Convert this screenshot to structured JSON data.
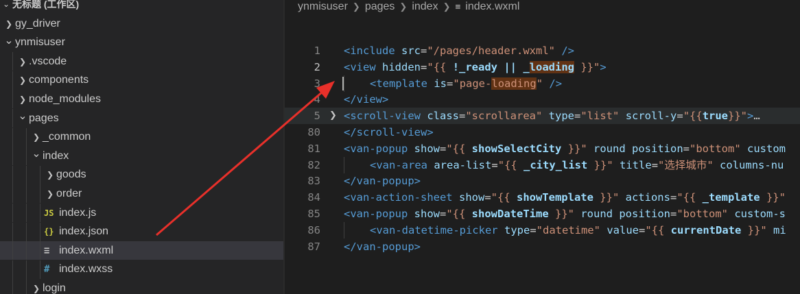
{
  "explorer": {
    "workspace_title": "无标题 (工作区)",
    "items": [
      {
        "label": "gy_driver",
        "chevron": "right",
        "icon": ""
      },
      {
        "label": "ynmisuser",
        "chevron": "down",
        "icon": ""
      },
      {
        "label": ".vscode",
        "chevron": "right",
        "icon": ""
      },
      {
        "label": "components",
        "chevron": "right",
        "icon": ""
      },
      {
        "label": "node_modules",
        "chevron": "right",
        "icon": ""
      },
      {
        "label": "pages",
        "chevron": "down",
        "icon": ""
      },
      {
        "label": "_common",
        "chevron": "right",
        "icon": ""
      },
      {
        "label": "index",
        "chevron": "down",
        "icon": ""
      },
      {
        "label": "goods",
        "chevron": "right",
        "icon": ""
      },
      {
        "label": "order",
        "chevron": "right",
        "icon": ""
      },
      {
        "label": "index.js",
        "chevron": "",
        "icon": "JS"
      },
      {
        "label": "index.json",
        "chevron": "",
        "icon": "{}"
      },
      {
        "label": "index.wxml",
        "chevron": "",
        "icon": "≡"
      },
      {
        "label": "index.wxss",
        "chevron": "",
        "icon": "#"
      },
      {
        "label": "login",
        "chevron": "right",
        "icon": ""
      }
    ],
    "selected_label": "index.wxml",
    "colors": {
      "js_icon": "#cbcb41",
      "json_icon": "#cbcb41",
      "wxml_icon": "#c5c5c5",
      "wxss_icon": "#519aba"
    }
  },
  "breadcrumb": {
    "segments": [
      "ynmisuser",
      "pages",
      "index",
      "index.wxml"
    ],
    "file_icon": "≡"
  },
  "editor": {
    "lines": [
      {
        "num": "1",
        "tokens": [
          [
            "t-tag",
            "<include"
          ],
          [
            "t-txt",
            " "
          ],
          [
            "t-attr",
            "src"
          ],
          [
            "t-txt",
            "="
          ],
          [
            "t-str",
            "\"/pages/header.wxml\""
          ],
          [
            "t-txt",
            " "
          ],
          [
            "t-tag",
            "/>"
          ]
        ]
      },
      {
        "num": "2",
        "active": true,
        "tokens": [
          [
            "t-tag",
            "<view"
          ],
          [
            "t-txt",
            " "
          ],
          [
            "t-attr",
            "hidden"
          ],
          [
            "t-txt",
            "="
          ],
          [
            "t-str",
            "\"{{ "
          ],
          [
            "t-mus",
            "!_ready || _"
          ],
          [
            "t-mus t-hi",
            "loading"
          ],
          [
            "t-str",
            " }}\""
          ],
          [
            "t-tag",
            ">"
          ]
        ]
      },
      {
        "num": "3",
        "indent": 1,
        "cursor": true,
        "tokens": [
          [
            "t-tag",
            "<template"
          ],
          [
            "t-txt",
            " "
          ],
          [
            "t-attr",
            "is"
          ],
          [
            "t-txt",
            "="
          ],
          [
            "t-str",
            "\"page-"
          ],
          [
            "t-str t-hi",
            "loading"
          ],
          [
            "t-str",
            "\""
          ],
          [
            "t-txt",
            " "
          ],
          [
            "t-tag",
            "/>"
          ]
        ]
      },
      {
        "num": "4",
        "tokens": [
          [
            "t-tag",
            "</view>"
          ]
        ]
      },
      {
        "num": "5",
        "folded": true,
        "highlight": true,
        "tokens": [
          [
            "t-tag",
            "<scroll-view"
          ],
          [
            "t-txt",
            " "
          ],
          [
            "t-attr",
            "class"
          ],
          [
            "t-txt",
            "="
          ],
          [
            "t-str",
            "\"scrollarea\""
          ],
          [
            "t-txt",
            " "
          ],
          [
            "t-attr",
            "type"
          ],
          [
            "t-txt",
            "="
          ],
          [
            "t-str",
            "\"list\""
          ],
          [
            "t-txt",
            " "
          ],
          [
            "t-attr",
            "scroll-y"
          ],
          [
            "t-txt",
            "="
          ],
          [
            "t-str",
            "\"{{"
          ],
          [
            "t-mus",
            "true"
          ],
          [
            "t-str",
            "}}\""
          ],
          [
            "t-tag",
            ">"
          ],
          [
            "ellipsis",
            "…"
          ]
        ]
      },
      {
        "num": "80",
        "tokens": [
          [
            "t-tag",
            "</scroll-view>"
          ]
        ]
      },
      {
        "num": "81",
        "tokens": [
          [
            "t-tag",
            "<van-popup"
          ],
          [
            "t-txt",
            " "
          ],
          [
            "t-attr",
            "show"
          ],
          [
            "t-txt",
            "="
          ],
          [
            "t-str",
            "\"{{ "
          ],
          [
            "t-mus",
            "showSelectCity"
          ],
          [
            "t-str",
            " }}\""
          ],
          [
            "t-txt",
            " "
          ],
          [
            "t-attr",
            "round"
          ],
          [
            "t-txt",
            " "
          ],
          [
            "t-attr",
            "position"
          ],
          [
            "t-txt",
            "="
          ],
          [
            "t-str",
            "\"bottom\""
          ],
          [
            "t-txt",
            " "
          ],
          [
            "t-attr",
            "custom"
          ]
        ]
      },
      {
        "num": "82",
        "indent": 1,
        "tokens": [
          [
            "t-tag",
            "<van-area"
          ],
          [
            "t-txt",
            " "
          ],
          [
            "t-attr",
            "area-list"
          ],
          [
            "t-txt",
            "="
          ],
          [
            "t-str",
            "\"{{ "
          ],
          [
            "t-mus",
            "_city_list"
          ],
          [
            "t-str",
            " }}\""
          ],
          [
            "t-txt",
            " "
          ],
          [
            "t-attr",
            "title"
          ],
          [
            "t-txt",
            "="
          ],
          [
            "t-str",
            "\"选择城市\""
          ],
          [
            "t-txt",
            " "
          ],
          [
            "t-attr",
            "columns-nu"
          ]
        ]
      },
      {
        "num": "83",
        "tokens": [
          [
            "t-tag",
            "</van-popup>"
          ]
        ]
      },
      {
        "num": "84",
        "tokens": [
          [
            "t-tag",
            "<van-action-sheet"
          ],
          [
            "t-txt",
            " "
          ],
          [
            "t-attr",
            "show"
          ],
          [
            "t-txt",
            "="
          ],
          [
            "t-str",
            "\"{{ "
          ],
          [
            "t-mus",
            "showTemplate"
          ],
          [
            "t-str",
            " }}\""
          ],
          [
            "t-txt",
            " "
          ],
          [
            "t-attr",
            "actions"
          ],
          [
            "t-txt",
            "="
          ],
          [
            "t-str",
            "\"{{ "
          ],
          [
            "t-mus",
            "_template"
          ],
          [
            "t-str",
            " }}\""
          ]
        ]
      },
      {
        "num": "85",
        "tokens": [
          [
            "t-tag",
            "<van-popup"
          ],
          [
            "t-txt",
            " "
          ],
          [
            "t-attr",
            "show"
          ],
          [
            "t-txt",
            "="
          ],
          [
            "t-str",
            "\"{{ "
          ],
          [
            "t-mus",
            "showDateTime"
          ],
          [
            "t-str",
            " }}\""
          ],
          [
            "t-txt",
            " "
          ],
          [
            "t-attr",
            "round"
          ],
          [
            "t-txt",
            " "
          ],
          [
            "t-attr",
            "position"
          ],
          [
            "t-txt",
            "="
          ],
          [
            "t-str",
            "\"bottom\""
          ],
          [
            "t-txt",
            " "
          ],
          [
            "t-attr",
            "custom-s"
          ]
        ]
      },
      {
        "num": "86",
        "indent": 1,
        "tokens": [
          [
            "t-tag",
            "<van-datetime-picker"
          ],
          [
            "t-txt",
            " "
          ],
          [
            "t-attr",
            "type"
          ],
          [
            "t-txt",
            "="
          ],
          [
            "t-str",
            "\"datetime\""
          ],
          [
            "t-txt",
            " "
          ],
          [
            "t-attr",
            "value"
          ],
          [
            "t-txt",
            "="
          ],
          [
            "t-str",
            "\"{{ "
          ],
          [
            "t-mus",
            "currentDate"
          ],
          [
            "t-str",
            " }}\""
          ],
          [
            "t-txt",
            " "
          ],
          [
            "t-attr",
            "mi"
          ]
        ]
      },
      {
        "num": "87",
        "tokens": [
          [
            "t-tag",
            "</van-popup>"
          ]
        ]
      }
    ]
  },
  "annotation": {
    "arrow_color": "#e8302a"
  }
}
